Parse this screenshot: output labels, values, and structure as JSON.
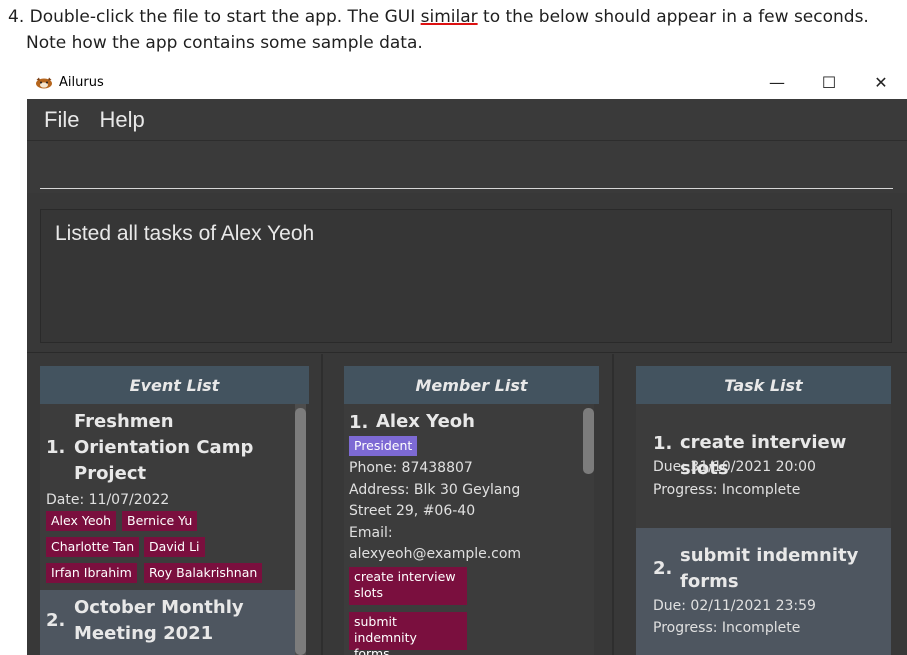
{
  "doc": {
    "line1_prefix": "4. Double-click the file to start the app. The GUI ",
    "line1_word": "similar",
    "line1_suffix": " to the below should appear in a few seconds.",
    "line2": "Note how the app contains some sample data."
  },
  "window": {
    "title": "Ailurus",
    "controls": {
      "minimize": "—",
      "maximize": "☐",
      "close": "✕"
    }
  },
  "menu": {
    "file": "File",
    "help": "Help"
  },
  "command": {
    "value": ""
  },
  "result": {
    "text": "Listed all tasks of Alex Yeoh"
  },
  "event_list": {
    "header": "Event List",
    "events": [
      {
        "index": "1.",
        "name_lines": [
          "Freshmen",
          "Orientation Camp",
          "Project"
        ],
        "date": "Date: 11/07/2022",
        "tags": [
          "Alex Yeoh",
          "Bernice Yu",
          "Charlotte Tan",
          "David Li",
          "Irfan Ibrahim",
          "Roy Balakrishnan"
        ]
      },
      {
        "index": "2.",
        "name_lines": [
          "October Monthly",
          "Meeting 2021"
        ]
      }
    ]
  },
  "member_list": {
    "header": "Member List",
    "members": [
      {
        "index": "1.",
        "name": "Alex Yeoh",
        "role": "President",
        "phone": "Phone: 87438807",
        "address_lines": [
          "Address: Blk 30 Geylang",
          "Street 29, #06-40"
        ],
        "email_label": "Email:",
        "email": "alexyeoh@example.com",
        "tasks": [
          [
            "create interview",
            "slots"
          ],
          [
            "submit indemnity",
            "forms"
          ]
        ]
      }
    ]
  },
  "task_list": {
    "header": "Task List",
    "tasks": [
      {
        "index": "1.",
        "name_lines": [
          "create interview slots"
        ],
        "due": "Due: 31/10/2021 20:00",
        "progress": "Progress: Incomplete"
      },
      {
        "index": "2.",
        "name_lines": [
          "submit indemnity",
          "forms"
        ],
        "due": "Due: 02/11/2021 23:59",
        "progress": "Progress: Incomplete"
      }
    ]
  },
  "colors": {
    "window_bg": "#383838",
    "header_bg": "#43535f",
    "tag_bg": "#7a0f3e",
    "role_tag_bg": "#7d6ad4",
    "selected_card_bg": "#4e5660",
    "underline": "#dd1111"
  },
  "icons": {
    "app_logo": "red-panda-icon"
  }
}
